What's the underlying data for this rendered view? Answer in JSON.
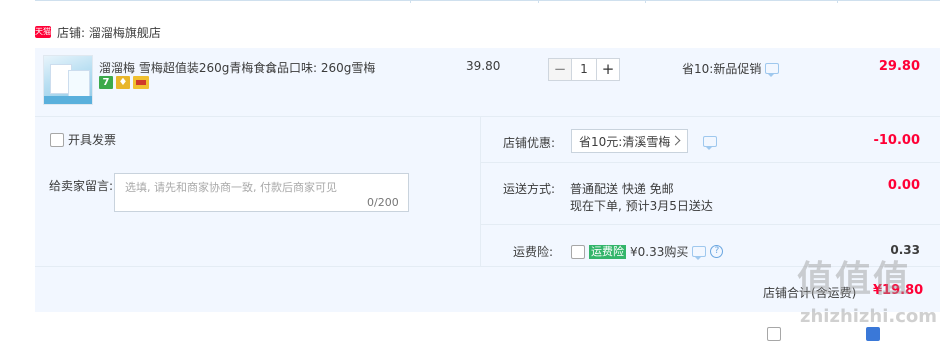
{
  "shop": {
    "badge": "天猫",
    "label": "店铺: 溜溜梅旗舰店"
  },
  "item": {
    "title": "溜溜梅 雪梅超值装260g青梅食...",
    "sku": "食品口味: 260g雪梅",
    "price": "39.80",
    "quantity": "1",
    "minus": "−",
    "plus": "+",
    "promo": "省10:新品促销",
    "total": "29.80",
    "service_icons": [
      "7",
      "♦",
      ""
    ]
  },
  "invoice": {
    "label": "开具发票"
  },
  "message": {
    "label": "给卖家留言:",
    "placeholder": "选填, 请先和商家协商一致, 付款后商家可见",
    "count": "0/200"
  },
  "shop_discount": {
    "label": "店铺优惠:",
    "selected": "省10元:清溪雪梅",
    "amount": "-10.00"
  },
  "shipping": {
    "label": "运送方式:",
    "line1": "普通配送 快递 免邮",
    "line2": "现在下单, 预计3月5日送达",
    "amount": "0.00"
  },
  "insurance": {
    "label": "运费险:",
    "badge": "运费险",
    "text": "¥0.33购买",
    "amount": "0.33"
  },
  "summary": {
    "label": "店铺合计(含运费)",
    "amount": "¥19.80"
  },
  "watermark": {
    "big": "值值值",
    "small": "zhizhizhi.com"
  },
  "colors": {
    "accent_red": "#ff0036",
    "panel_bg": "#f2f7ff",
    "insurance_green": "#33b56a"
  }
}
